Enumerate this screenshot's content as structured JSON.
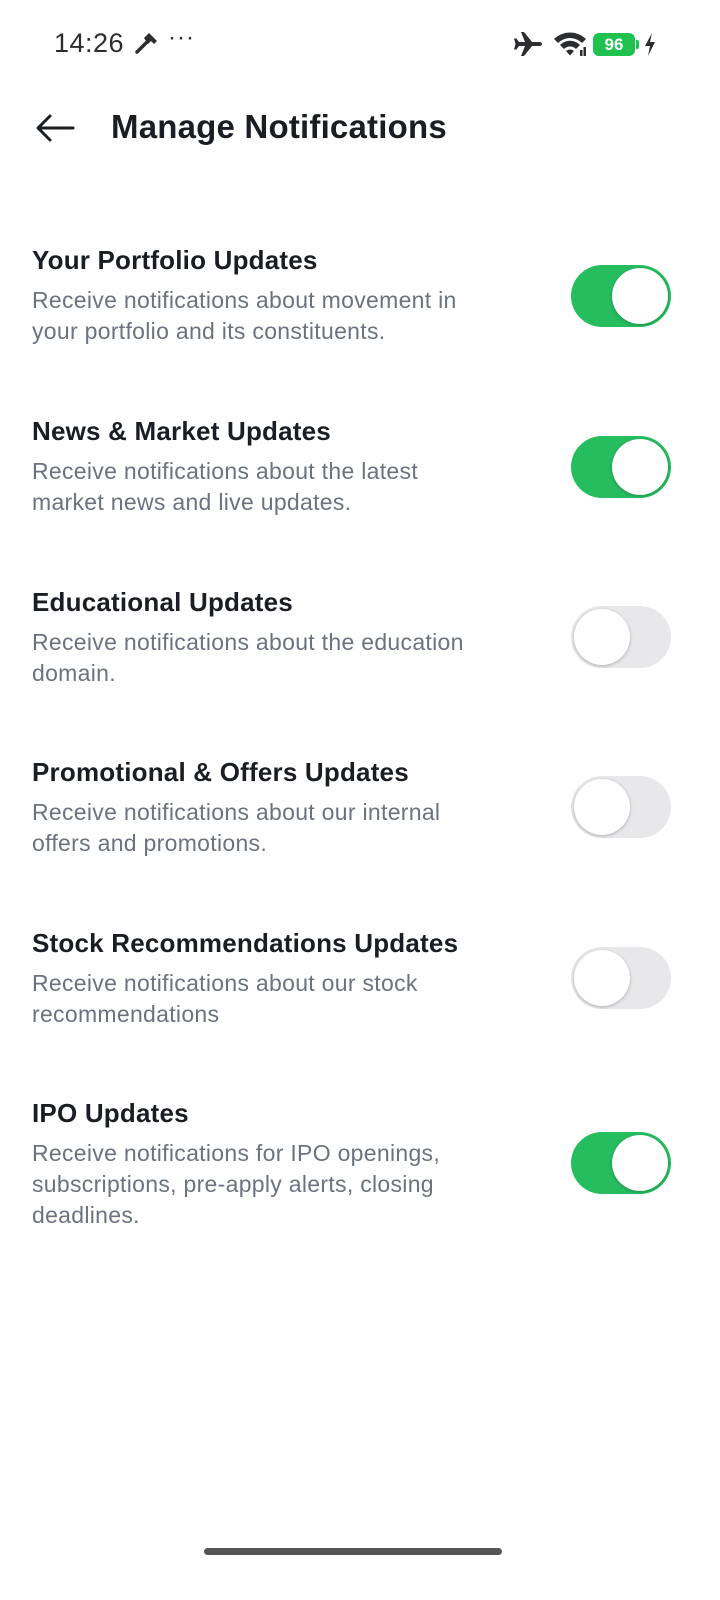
{
  "status_bar": {
    "time": "14:26",
    "dots": "···",
    "battery_level": "96",
    "icons": [
      "hammer-icon",
      "airplane-icon",
      "wifi-icon",
      "battery-icon",
      "charging-icon"
    ]
  },
  "header": {
    "title": "Manage Notifications",
    "back_icon": "arrow-left-icon"
  },
  "settings": [
    {
      "title": "Your Portfolio Updates",
      "description": "Receive notifications about movement in your portfolio and its constituents.",
      "enabled": true
    },
    {
      "title": "News & Market Updates",
      "description": "Receive notifications about the latest market news and live updates.",
      "enabled": true
    },
    {
      "title": "Educational Updates",
      "description": "Receive notifications about the education domain.",
      "enabled": false
    },
    {
      "title": "Promotional & Offers Updates",
      "description": "Receive notifications about our internal offers and promotions.",
      "enabled": false
    },
    {
      "title": "Stock Recommendations Updates",
      "description": "Receive notifications about our stock recommendations",
      "enabled": false
    },
    {
      "title": "IPO Updates",
      "description": "Receive notifications for IPO openings, subscriptions, pre-apply alerts, closing deadlines.",
      "enabled": true
    }
  ],
  "colors": {
    "toggle_on": "#26bd5f",
    "toggle_off": "#e8e8ea",
    "battery": "#20c24f",
    "title_text": "#1a1d24",
    "description_text": "#6b7280"
  }
}
